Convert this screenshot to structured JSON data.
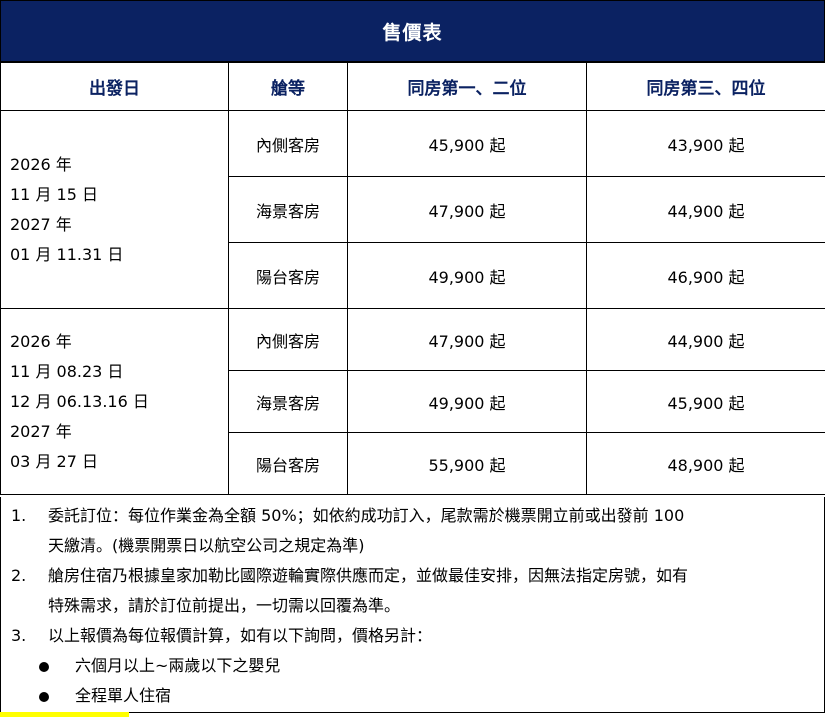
{
  "title": "售價表",
  "headers": [
    "出發日",
    "艙等",
    "同房第一、二位",
    "同房第三、四位"
  ],
  "groups": [
    {
      "dates": [
        "2026 年",
        "11 月 15 日",
        "2027 年",
        "01 月 11.31 日"
      ],
      "rows": [
        {
          "cabin": "內側客房",
          "price12": "45,900 起",
          "price34": "43,900 起"
        },
        {
          "cabin": "海景客房",
          "price12": "47,900 起",
          "price34": "44,900 起"
        },
        {
          "cabin": "陽台客房",
          "price12": "49,900 起",
          "price34": "46,900 起"
        }
      ]
    },
    {
      "dates": [
        "2026 年",
        "11 月 08.23 日",
        "12 月 06.13.16 日",
        "2027 年",
        "03 月 27 日"
      ],
      "rows": [
        {
          "cabin": "內側客房",
          "price12": "47,900 起",
          "price34": "44,900 起"
        },
        {
          "cabin": "海景客房",
          "price12": "49,900 起",
          "price34": "45,900 起"
        },
        {
          "cabin": "陽台客房",
          "price12": "55,900 起",
          "price34": "48,900 起"
        }
      ]
    }
  ],
  "notes": [
    {
      "num": "1.",
      "lines": [
        "委託訂位：每位作業金為全額 50%；如依約成功訂入，尾款需於機票開立前或出發前 100",
        "天繳清。(機票開票日以航空公司之規定為準)"
      ]
    },
    {
      "num": "2.",
      "lines": [
        "艙房住宿乃根據皇家加勒比國際遊輪實際供應而定，並做最佳安排，因無法指定房號，如有",
        "特殊需求，請於訂位前提出，一切需以回覆為準。"
      ]
    },
    {
      "num": "3.",
      "lines": [
        "以上報價為每位報價計算，如有以下詢問，價格另計："
      ]
    }
  ],
  "bullets": [
    "六個月以上~兩歲以下之嬰兒",
    "全程單人住宿"
  ]
}
